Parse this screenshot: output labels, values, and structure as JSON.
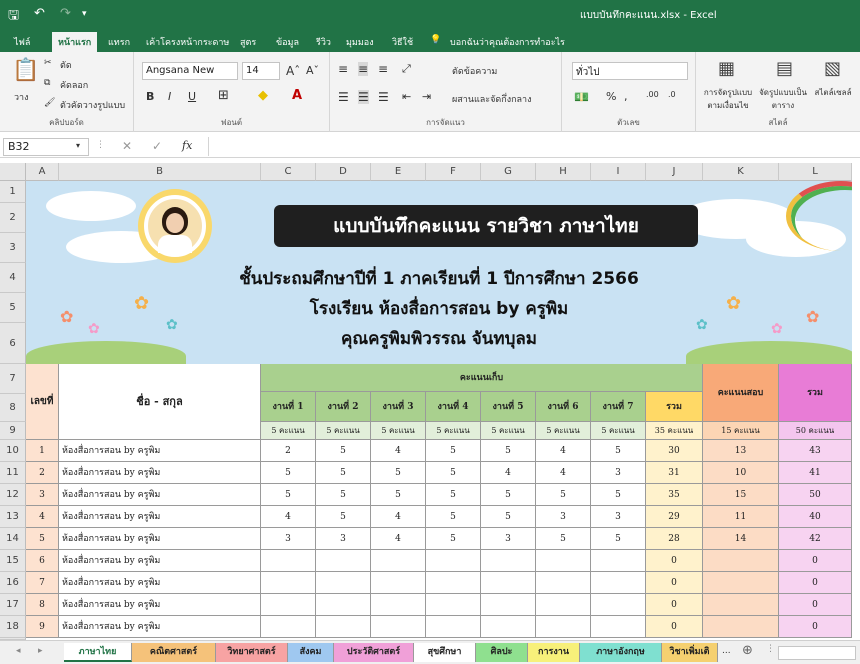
{
  "titlebar": {
    "title": "แบบบันทึกคะแนน.xlsx  -  Excel"
  },
  "tabs": [
    "ไฟล์",
    "หน้าแรก",
    "แทรก",
    "เค้าโครงหน้ากระดาษ",
    "สูตร",
    "ข้อมูล",
    "รีวิว",
    "มุมมอง",
    "วิธีใช้"
  ],
  "tell_me": "บอกฉันว่าคุณต้องการทำอะไร",
  "ribbon": {
    "paste": "วาง",
    "cut": "ตัด",
    "copy": "คัดลอก",
    "format_painter": "ตัวคัดวางรูปแบบ",
    "clipboard": "คลิปบอร์ด",
    "font_name": "Angsana New",
    "font_size": "14",
    "font_group": "ฟอนต์",
    "wrap": "ตัดข้อความ",
    "merge": "ผสานและจัดกึ่งกลาง",
    "alignment": "การจัดแนว",
    "number_format": "ทั่วไป",
    "number_group": "ตัวเลข",
    "cond_format": "การจัดรูปแบบตามเงื่อนไข",
    "format_table": "จัดรูปแบบเป็นตาราง",
    "cell_styles": "สไตล์เซลล์",
    "styles_group": "สไตล์"
  },
  "namebox": "B32",
  "columns": [
    "A",
    "B",
    "C",
    "D",
    "E",
    "F",
    "G",
    "H",
    "I",
    "J",
    "K",
    "L"
  ],
  "banner": {
    "title": "แบบบันทึกคะแนน รายวิชา ภาษาไทย",
    "line1": "ชั้นประถมศึกษาปีที่ 1 ภาคเรียนที่ 1 ปีการศึกษา 2566",
    "line2": "โรงเรียน ห้องสื่อการสอน by ครูพิม",
    "line3": "คุณครูพิมพิวรรณ  จันทบุลม"
  },
  "table": {
    "no_header": "เลขที่",
    "name_header": "ชื่อ - สกุล",
    "collect_header": "คะแนนเก็บ",
    "tasks": [
      "งานที่ 1",
      "งานที่ 2",
      "งานที่ 3",
      "งานที่ 4",
      "งานที่ 5",
      "งานที่ 6",
      "งานที่ 7"
    ],
    "task_points": "5 คะแนน",
    "total_label": "รวม",
    "total_points": "35 คะแนน",
    "exam_header": "คะแนนสอบ",
    "exam_points": "15 คะแนน",
    "sum_header": "รวม",
    "sum_points": "50 คะแนน",
    "rows": [
      {
        "no": "1",
        "name": "ห้องสื่อการสอน by ครูพิม",
        "t": [
          "2",
          "5",
          "4",
          "5",
          "5",
          "4",
          "5"
        ],
        "tot": "30",
        "exam": "13",
        "sum": "43"
      },
      {
        "no": "2",
        "name": "ห้องสื่อการสอน by ครูพิม",
        "t": [
          "5",
          "5",
          "5",
          "5",
          "4",
          "4",
          "3"
        ],
        "tot": "31",
        "exam": "10",
        "sum": "41"
      },
      {
        "no": "3",
        "name": "ห้องสื่อการสอน by ครูพิม",
        "t": [
          "5",
          "5",
          "5",
          "5",
          "5",
          "5",
          "5"
        ],
        "tot": "35",
        "exam": "15",
        "sum": "50"
      },
      {
        "no": "4",
        "name": "ห้องสื่อการสอน by ครูพิม",
        "t": [
          "4",
          "5",
          "4",
          "5",
          "5",
          "3",
          "3"
        ],
        "tot": "29",
        "exam": "11",
        "sum": "40"
      },
      {
        "no": "5",
        "name": "ห้องสื่อการสอน by ครูพิม",
        "t": [
          "3",
          "3",
          "4",
          "5",
          "3",
          "5",
          "5"
        ],
        "tot": "28",
        "exam": "14",
        "sum": "42"
      },
      {
        "no": "6",
        "name": "ห้องสื่อการสอน by ครูพิม",
        "t": [
          "",
          "",
          "",
          "",
          "",
          "",
          ""
        ],
        "tot": "0",
        "exam": "",
        "sum": "0"
      },
      {
        "no": "7",
        "name": "ห้องสื่อการสอน by ครูพิม",
        "t": [
          "",
          "",
          "",
          "",
          "",
          "",
          ""
        ],
        "tot": "0",
        "exam": "",
        "sum": "0"
      },
      {
        "no": "8",
        "name": "ห้องสื่อการสอน by ครูพิม",
        "t": [
          "",
          "",
          "",
          "",
          "",
          "",
          ""
        ],
        "tot": "0",
        "exam": "",
        "sum": "0"
      },
      {
        "no": "9",
        "name": "ห้องสื่อการสอน by ครูพิม",
        "t": [
          "",
          "",
          "",
          "",
          "",
          "",
          ""
        ],
        "tot": "0",
        "exam": "",
        "sum": "0"
      }
    ]
  },
  "sheet_tabs": [
    {
      "label": "ภาษาไทย",
      "color": "#ffffff"
    },
    {
      "label": "คณิตศาสตร์",
      "color": "#f5c27a"
    },
    {
      "label": "วิทยาศาสตร์",
      "color": "#f7a3a3"
    },
    {
      "label": "สังคม",
      "color": "#9fc8f0"
    },
    {
      "label": "ประวัติศาสตร์",
      "color": "#f0a0d8"
    },
    {
      "label": "สุขศึกษา",
      "color": "#ffffff"
    },
    {
      "label": "ศิลปะ",
      "color": "#8fe08f"
    },
    {
      "label": "การงาน",
      "color": "#f7f07a"
    },
    {
      "label": "ภาษาอังกฤษ",
      "color": "#7fe0d0"
    },
    {
      "label": "วิชาเพิ่มเติ",
      "color": "#f5d070"
    }
  ],
  "more_tabs": "..."
}
